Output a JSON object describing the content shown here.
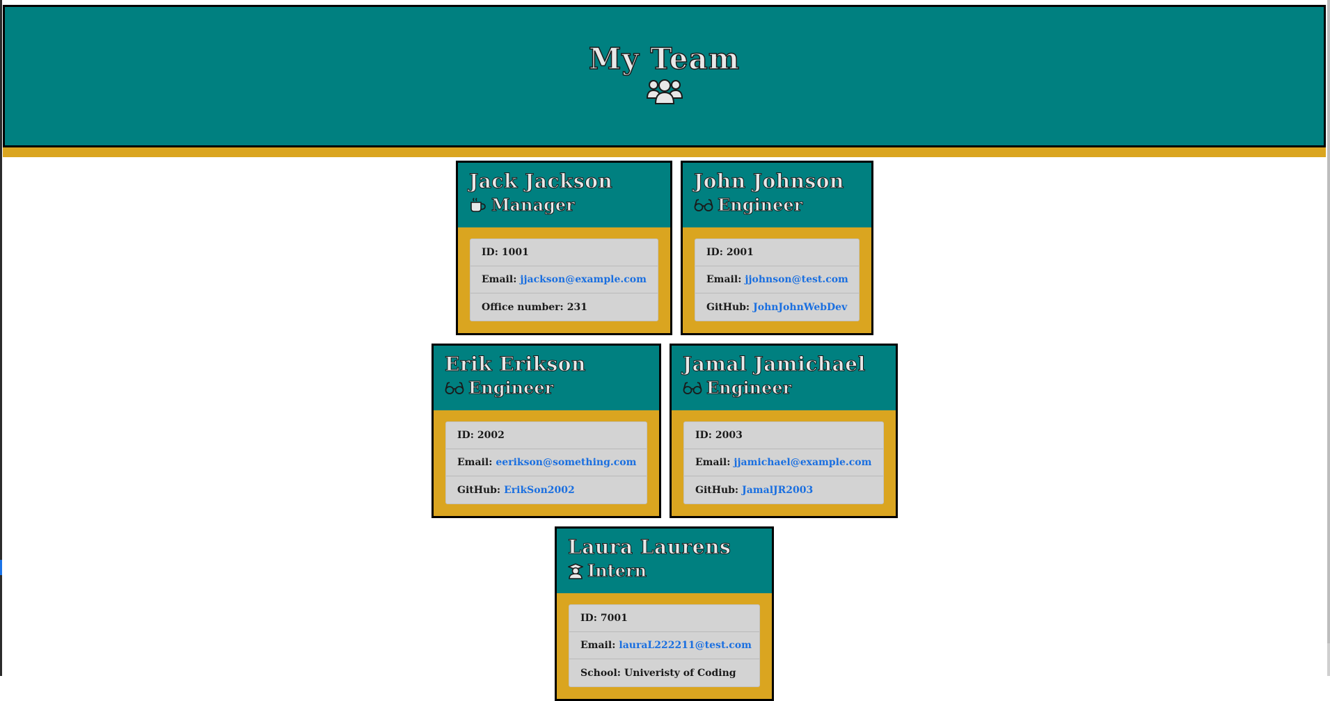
{
  "header": {
    "title": "My Team",
    "icon": "users-icon",
    "color": "#008080",
    "accent": "#daa520"
  },
  "cards": [
    {
      "name": "Jack Jackson",
      "role": "Manager",
      "role_icon": "mug-icon",
      "id_label": "ID:",
      "id": "1001",
      "email_label": "Email:",
      "email": "jjackson@example.com",
      "extra_label": "Office number:",
      "extra": "231"
    },
    {
      "name": "John Johnson",
      "role": "Engineer",
      "role_icon": "glasses-icon",
      "id_label": "ID:",
      "id": "2001",
      "email_label": "Email:",
      "email": "jjohnson@test.com",
      "extra_label": "GitHub:",
      "extra": "JohnJohnWebDev"
    },
    {
      "name": "Erik Erikson",
      "role": "Engineer",
      "role_icon": "glasses-icon",
      "id_label": "ID:",
      "id": "2002",
      "email_label": "Email:",
      "email": "eerikson@something.com",
      "extra_label": "GitHub:",
      "extra": "ErikSon2002"
    },
    {
      "name": "Jamal Jamichael",
      "role": "Engineer",
      "role_icon": "glasses-icon",
      "id_label": "ID:",
      "id": "2003",
      "email_label": "Email:",
      "email": "jjamichael@example.com",
      "extra_label": "GitHub:",
      "extra": "JamalJR2003"
    },
    {
      "name": "Laura Laurens",
      "role": "Intern",
      "role_icon": "graduate-icon",
      "id_label": "ID:",
      "id": "7001",
      "email_label": "Email:",
      "email": "lauraL222211@test.com",
      "extra_label": "School:",
      "extra": "Univeristy of Coding"
    }
  ]
}
